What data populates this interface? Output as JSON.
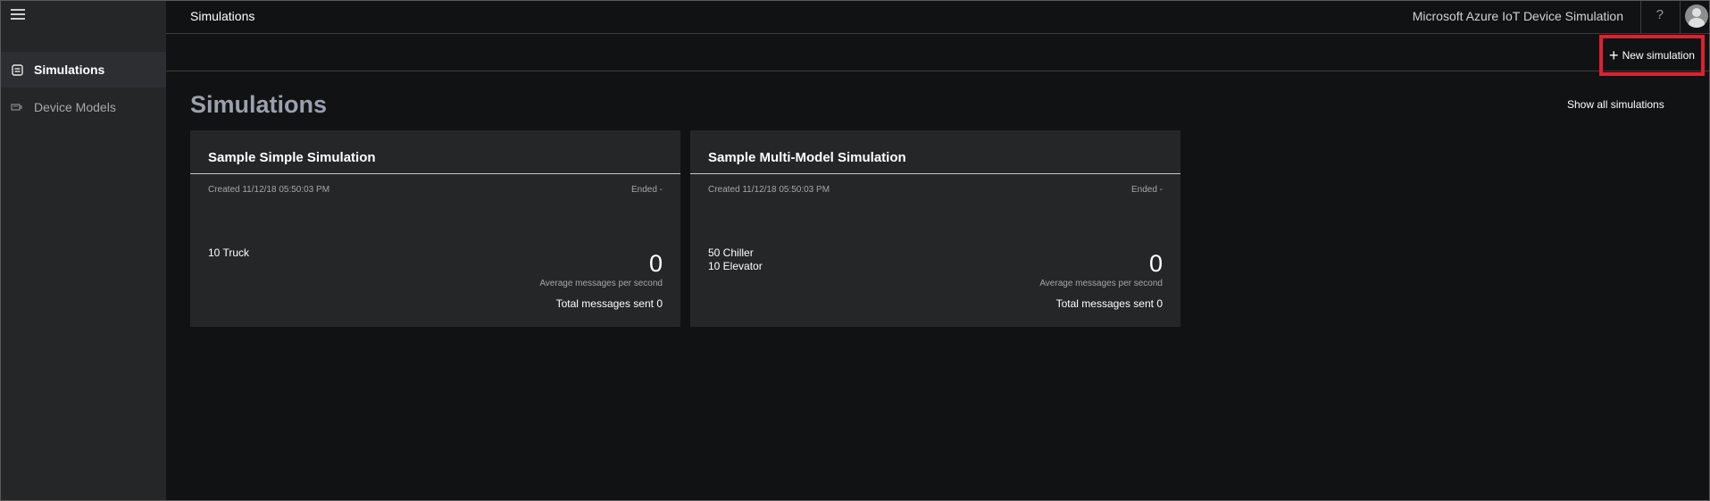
{
  "sidebar": {
    "items": [
      {
        "label": "Simulations",
        "icon": "simulations-icon",
        "active": true
      },
      {
        "label": "Device Models",
        "icon": "device-models-icon",
        "active": false
      }
    ]
  },
  "header": {
    "breadcrumb": "Simulations",
    "app_title": "Microsoft Azure IoT Device Simulation",
    "help_glyph": "?"
  },
  "toolbar": {
    "new_simulation_label": "New simulation",
    "highlight_color": "#e0202e"
  },
  "main": {
    "title": "Simulations",
    "show_all_label": "Show all simulations",
    "cards": [
      {
        "title": "Sample Simple Simulation",
        "created": "Created 11/12/18 05:50:03 PM",
        "ended": "Ended -",
        "devices": [
          "10 Truck"
        ],
        "avg_value": "0",
        "avg_label": "Average messages per second",
        "total": "Total messages sent 0"
      },
      {
        "title": "Sample Multi-Model Simulation",
        "created": "Created 11/12/18 05:50:03 PM",
        "ended": "Ended -",
        "devices": [
          "50 Chiller",
          "10 Elevator"
        ],
        "avg_value": "0",
        "avg_label": "Average messages per second",
        "total": "Total messages sent 0"
      }
    ]
  }
}
